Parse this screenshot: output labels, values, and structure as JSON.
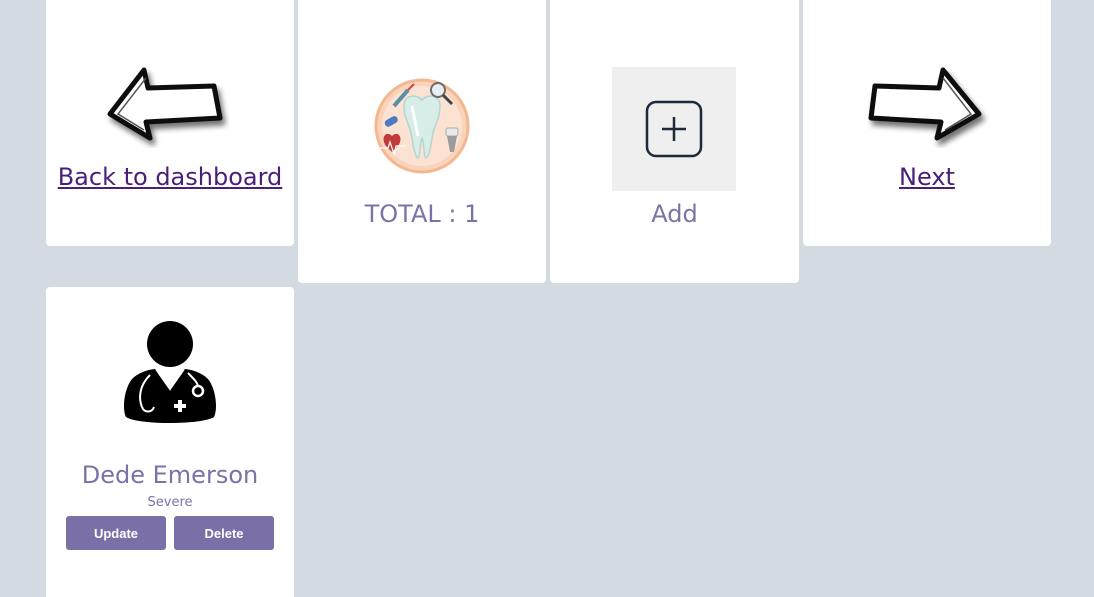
{
  "nav": {
    "back_label": "Back to dashboard",
    "next_label": "Next"
  },
  "summary": {
    "total_label": "TOTAL : 1"
  },
  "add": {
    "label": "Add"
  },
  "patients": [
    {
      "name": "Dede Emerson",
      "status": "Severe",
      "update_label": "Update",
      "delete_label": "Delete"
    }
  ],
  "colors": {
    "background": "#d3dae2",
    "card": "#ffffff",
    "link": "#4a1f7a",
    "caption": "#7d72a7",
    "button": "#7b6fa8"
  }
}
